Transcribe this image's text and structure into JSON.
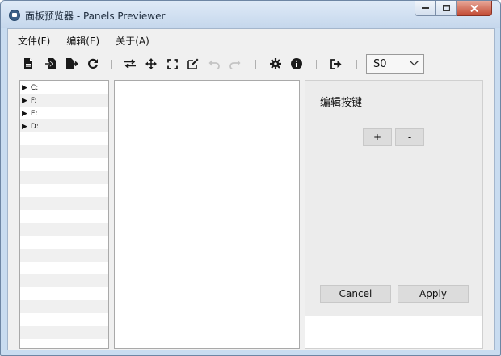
{
  "window": {
    "title": "面板预览器 - Panels Previewer"
  },
  "menu": [
    {
      "label": "文件(F)"
    },
    {
      "label": "编辑(E)"
    },
    {
      "label": "关于(A)"
    }
  ],
  "toolbar": {
    "icons": [
      "new-file-icon",
      "import-icon",
      "export-icon",
      "refresh-icon",
      "swap-icon",
      "move-icon",
      "fullscreen-icon",
      "edit-icon",
      "undo-icon",
      "redo-icon",
      "settings-icon",
      "info-icon",
      "exit-icon"
    ],
    "combo_value": "S0"
  },
  "tree": {
    "items": [
      {
        "label": "C:"
      },
      {
        "label": "F:"
      },
      {
        "label": "E:"
      },
      {
        "label": "D:"
      }
    ]
  },
  "side": {
    "title": "编辑按键",
    "add_label": "+",
    "remove_label": "-",
    "cancel_label": "Cancel",
    "apply_label": "Apply"
  }
}
